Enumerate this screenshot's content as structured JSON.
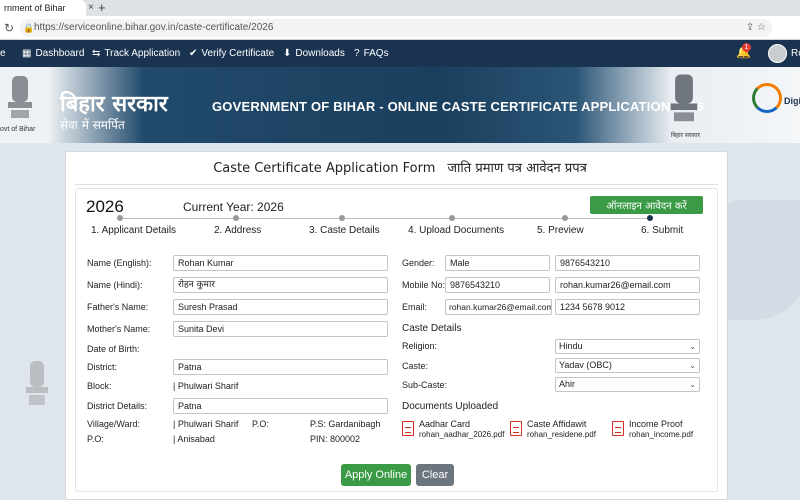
{
  "browser": {
    "tab_title": "rnment of Bihar",
    "tab_close": "×",
    "new_tab": "+",
    "url": "https://serviceonline.bihar.gov.in/caste-certificate/2026",
    "back": "←",
    "forward": "→",
    "reload": "↻"
  },
  "navbar": {
    "home_fragment": "e",
    "items": [
      {
        "label": "Dashboard",
        "icon": "dashboard-icon"
      },
      {
        "label": "Track Application",
        "icon": "track-icon"
      },
      {
        "label": "Verify Certificate",
        "icon": "check-icon"
      },
      {
        "label": "Downloads",
        "icon": "download-icon"
      },
      {
        "label": "FAQs",
        "icon": "help-icon"
      }
    ],
    "notification_count": "1",
    "user_fragment": "Ro"
  },
  "banner": {
    "govt_caption": "ovt of Bihar",
    "bihar_hindi": "बिहार सरकार",
    "seva": "सेवा में समर्पित",
    "title": "GOVERNMENT OF BIHAR - ONLINE CASTE CERTIFICATE APPLICATION 2026",
    "emblem_caption": "बिहार सरकार",
    "digital_fragment": "Digit"
  },
  "form": {
    "title_en": "Caste Certificate Application Form",
    "title_hi": "जाति प्रमाण पत्र आवेदन प्रपत्र",
    "year": "2026",
    "current_year": "Current Year: 2026",
    "apply_online_hindi": "ऑनलाइन आवेदन करें",
    "steps": [
      "1. Applicant Details",
      "2. Address",
      "3. Caste Details",
      "4. Upload Documents",
      "5. Preview",
      "6. Submit"
    ],
    "left": {
      "name_en_label": "Name (English):",
      "name_en": "Rohan Kumar",
      "name_hi_label": "Name (Hindi):",
      "name_hi": "रोहन कुमार",
      "father_label": "Father's Name:",
      "father": "Suresh Prasad",
      "mother_label": "Mother's Name:",
      "mother": "Sunita Devi",
      "dob_label": "Date of Birth:",
      "district_label": "District:",
      "district": "Patna",
      "block_label": "Block:",
      "block": "| Phulwari Sharif",
      "district_details_label": "District Details:",
      "district_details": "Patna",
      "village_label": "Village/Ward:",
      "village": "| Phulwari Sharif",
      "po_inline_label": "P.O:",
      "ps": "P.S: Gardanibagh",
      "po_label": "P.O:",
      "po": "| Anisabad",
      "pin": "PIN: 800002"
    },
    "right": {
      "gender_label": "Gender:",
      "gender": "Male",
      "phone_extra": "9876543210",
      "mobile_label": "Mobile No:",
      "mobile": "9876543210",
      "email_extra": "rohan.kumar26@email.com",
      "email_label": "Email:",
      "email": "rohan.kumar26@email.com",
      "aadhar": "1234 5678 9012",
      "caste_details_head": "Caste Details",
      "religion_label": "Religion:",
      "religion": "Hindu",
      "caste_label": "Caste:",
      "caste": "Yadav (OBC)",
      "subcaste_label": "Sub-Caste:",
      "subcaste": "Ahir",
      "docs_head": "Documents Uploaded",
      "docs": [
        {
          "title": "Aadhar Card",
          "file": "rohan_aadhar_2026.pdf"
        },
        {
          "title": "Caste Affidawit",
          "file": "rohan_residene.pdf"
        },
        {
          "title": "Income Proof",
          "file": "rohan_income.pdf"
        }
      ]
    },
    "apply_button": "Apply Online",
    "clear_button": "Clear"
  }
}
